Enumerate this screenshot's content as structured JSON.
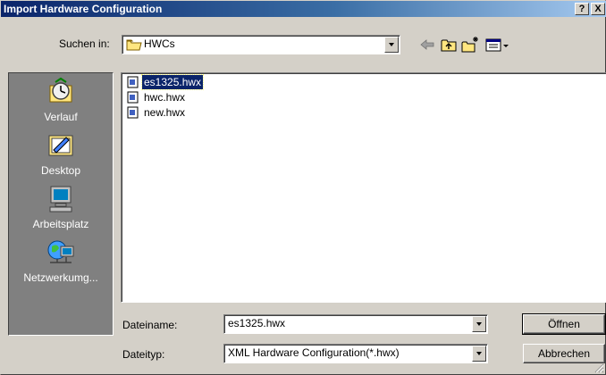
{
  "window": {
    "title": "Import Hardware Configuration",
    "help_label": "?",
    "close_label": "X"
  },
  "lookin": {
    "label": "Suchen in:",
    "value": "HWCs"
  },
  "toolbar": {
    "icons": [
      "back-arrow-icon",
      "up-folder-icon",
      "new-folder-icon",
      "view-menu-icon"
    ]
  },
  "places": [
    {
      "label": "Verlauf",
      "icon": "history-icon"
    },
    {
      "label": "Desktop",
      "icon": "desktop-icon"
    },
    {
      "label": "Arbeitsplatz",
      "icon": "my-computer-icon"
    },
    {
      "label": "Netzwerkumg...",
      "icon": "network-icon"
    }
  ],
  "files": [
    {
      "name": "es1325.hwx",
      "selected": true
    },
    {
      "name": "hwc.hwx",
      "selected": false
    },
    {
      "name": "new.hwx",
      "selected": false
    }
  ],
  "filename": {
    "label": "Dateiname:",
    "value": "es1325.hwx"
  },
  "filetype": {
    "label": "Dateityp:",
    "value": "XML Hardware Configuration(*.hwx)"
  },
  "buttons": {
    "open": "Öffnen",
    "cancel": "Abbrechen"
  },
  "colors": {
    "titlebar": "#0a246a",
    "face": "#d4d0c8",
    "places_bg": "#808080",
    "selection": "#0a246a"
  }
}
